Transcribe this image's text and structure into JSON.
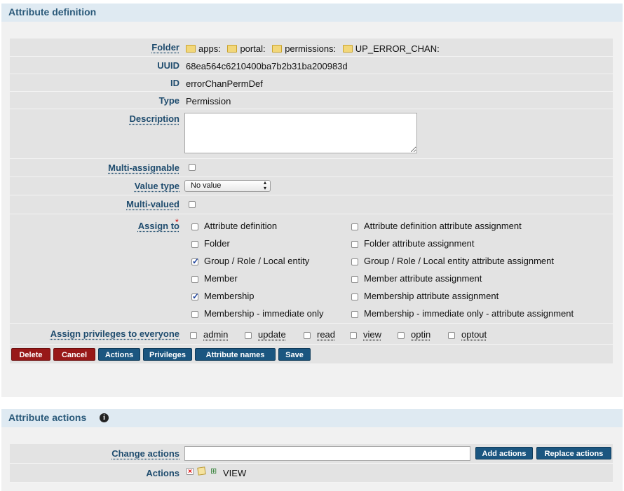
{
  "attr_def": {
    "title": "Attribute definition",
    "folder": {
      "label": "Folder",
      "path": [
        "apps:",
        "portal:",
        "permissions:",
        "UP_ERROR_CHAN:"
      ]
    },
    "uuid": {
      "label": "UUID",
      "value": "68ea564c6210400ba7b2b31ba200983d"
    },
    "id": {
      "label": "ID",
      "value": "errorChanPermDef"
    },
    "type": {
      "label": "Type",
      "value": "Permission"
    },
    "description": {
      "label": "Description",
      "value": ""
    },
    "multi_assignable": {
      "label": "Multi-assignable",
      "checked": false
    },
    "value_type": {
      "label": "Value type",
      "selected": "No value"
    },
    "multi_valued": {
      "label": "Multi-valued",
      "checked": false
    },
    "assign_to": {
      "label": "Assign to",
      "required_mark": "*",
      "left": [
        {
          "label": "Attribute definition",
          "checked": false
        },
        {
          "label": "Folder",
          "checked": false
        },
        {
          "label": "Group / Role / Local entity",
          "checked": true
        },
        {
          "label": "Member",
          "checked": false
        },
        {
          "label": "Membership",
          "checked": true
        },
        {
          "label": "Membership - immediate only",
          "checked": false
        }
      ],
      "right": [
        {
          "label": "Attribute definition attribute assignment",
          "checked": false
        },
        {
          "label": "Folder attribute assignment",
          "checked": false
        },
        {
          "label": "Group / Role / Local entity attribute assignment",
          "checked": false
        },
        {
          "label": "Member attribute assignment",
          "checked": false
        },
        {
          "label": "Membership attribute assignment",
          "checked": false
        },
        {
          "label": "Membership - immediate only - attribute assignment",
          "checked": false
        }
      ]
    },
    "privileges": {
      "label": "Assign privileges to everyone",
      "items": [
        "admin",
        "update",
        "read",
        "view",
        "optin",
        "optout"
      ]
    },
    "buttons": {
      "delete": "Delete",
      "cancel": "Cancel",
      "actions": "Actions",
      "privileges": "Privileges",
      "attribute_names": "Attribute names",
      "save": "Save"
    }
  },
  "attr_actions": {
    "title": "Attribute actions",
    "change_actions": {
      "label": "Change actions",
      "value": ""
    },
    "add_button": "Add actions",
    "replace_button": "Replace actions",
    "actions": {
      "label": "Actions",
      "value": "VIEW"
    }
  },
  "colors": {
    "panel_head": "#dfeaf2",
    "title_text": "#2b5a7a",
    "label_text": "#1f4c6e",
    "danger": "#981818",
    "primary": "#1b5680"
  }
}
